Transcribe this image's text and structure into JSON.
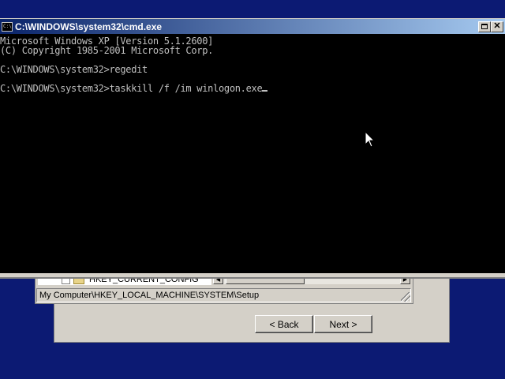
{
  "console": {
    "title": "C:\\WINDOWS\\system32\\cmd.exe",
    "lines": [
      "Microsoft Windows XP [Version 5.1.2600]",
      "(C) Copyright 1985-2001 Microsoft Corp.",
      "",
      "C:\\WINDOWS\\system32>regedit",
      "",
      "C:\\WINDOWS\\system32>taskkill /f /im winlogon.exe"
    ],
    "icon_label": "C:\\",
    "text_color": "#c0c0c0",
    "background_color": "#000000"
  },
  "regedit": {
    "tree_item": "HKEY_CURRENT_CONFIG",
    "status_path": "My Computer\\HKEY_LOCAL_MACHINE\\SYSTEM\\Setup"
  },
  "wizard": {
    "back_label": "< Back",
    "next_label": "Next >"
  },
  "icons": {
    "titlebar": "console-icon",
    "maximize": "maximize-icon",
    "close": "close-icon",
    "pointer": "mouse-pointer-icon"
  },
  "colors": {
    "desktop": "#0c1a73",
    "titlebar_start": "#0a246a",
    "titlebar_end": "#a6caf0",
    "chrome": "#d4d0c8"
  }
}
